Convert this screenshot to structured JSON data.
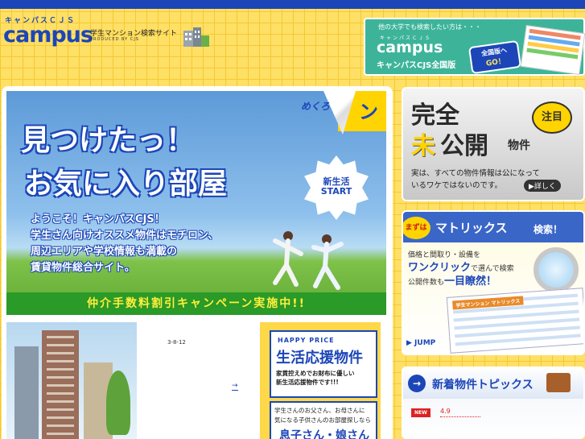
{
  "header": {
    "logo_kana": "キャンパスＣＪＳ",
    "logo_word": "campus",
    "tagline": "学生マンション検索サイト",
    "produced": "PRODUCED BY CJS"
  },
  "national_banner": {
    "question": "他の大学でも検索したい方は・・・",
    "kana": "キャンパスＣＪＳ",
    "word": "campus",
    "sub": "キャンパスCJS全国版",
    "go_line1": "全国版へ",
    "go_line2": "GO！"
  },
  "hero": {
    "headline1": "見つけたっ！",
    "headline2": "お気に入り部屋",
    "flip_label": "めくろ",
    "flip_char": "ン",
    "badge_line1": "新生活",
    "badge_line2": "START",
    "welcome_lines": [
      "ようこそ！キャンパスCJS！",
      "学生さん向けオススメ物件はモチロン、",
      "周辺エリアや学校情報も満載の",
      "賃貸物件総合サイト。"
    ],
    "campaign": "仲介手数料割引キャンペーン実施中!!"
  },
  "listing": {
    "address": "3-8-12",
    "arrow": "→"
  },
  "happy_price": {
    "label": "HAPPY PRICE",
    "title": "生活応援物件",
    "desc_line1": "家賃控えめでお財布に優しい",
    "desc_line2": "新生活応援物件です!!!",
    "parent_line1": "学生さんのお父さん、お母さんに",
    "parent_line2": "気になる子供さんのお部屋探しなら",
    "sons": "息子さん・娘さん"
  },
  "unpublished": {
    "line1": "完全",
    "mi": "未",
    "kokai": "公開",
    "bukken": "物件",
    "chumoku": "注目",
    "desc_line1": "実は、すべての物件情報は公になって",
    "desc_line2": "いるワケではないのです。",
    "more": "▶詳しく"
  },
  "matrix": {
    "mazu": "まずは",
    "title": "マトリックス",
    "search": "検索！",
    "line1": "価格と間取り・設備を",
    "line2_big": "ワンクリック",
    "line2_rest": "で選んで検索",
    "line3": "公開件数も",
    "line3_big": "一目瞭然！",
    "sheet_tag": "学生マンション マトリックス",
    "jump": "▶ JUMP"
  },
  "topics": {
    "icon": "→",
    "title": "新着物件トピックス",
    "new_badge": "NEW",
    "date": "4.9"
  }
}
